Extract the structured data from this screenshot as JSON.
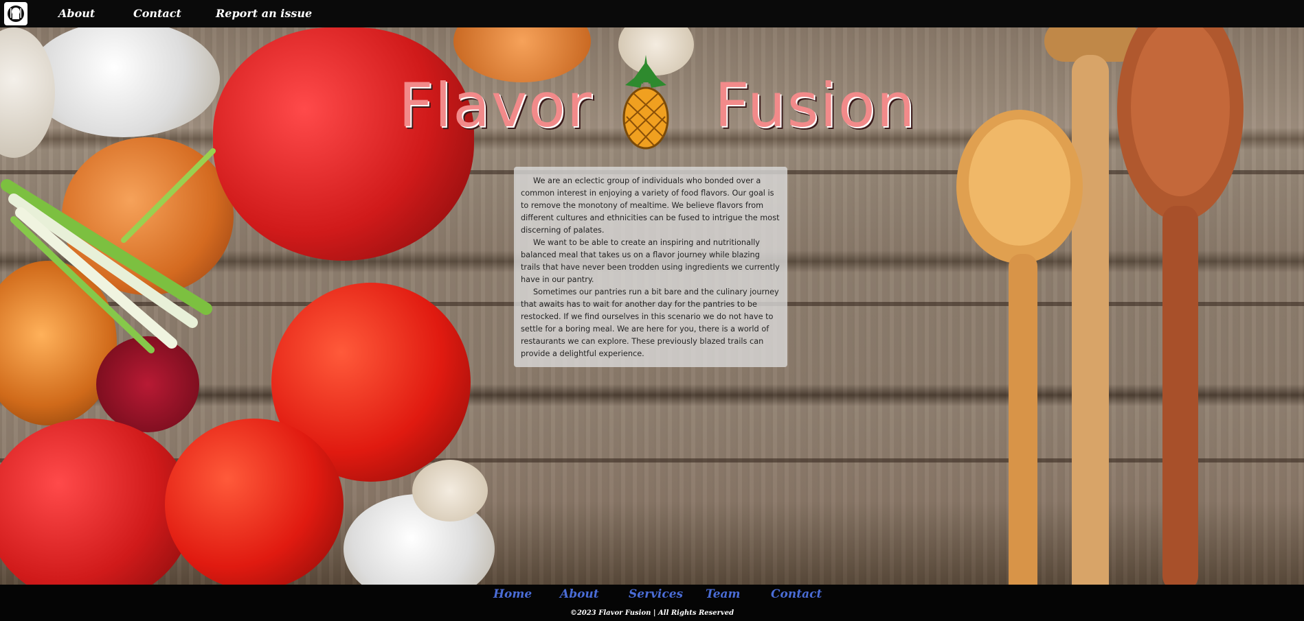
{
  "topnav": {
    "logo_icon": "chef-utensils-icon",
    "links": [
      "About",
      "Contact",
      "Report an issue"
    ]
  },
  "hero": {
    "title_left": "Flavor",
    "title_right": "Fusion",
    "title_color": "#f28a8a",
    "divider_icon": "pineapple-icon"
  },
  "about": {
    "paragraphs": [
      "We are an eclectic group of individuals who bonded over a common interest in enjoying a variety of food flavors. Our goal is to remove the monotony of mealtime. We believe flavors from different cultures and ethnicities can be fused to intrigue the most discerning of palates.",
      "We want to be able to create an inspiring and nutritionally balanced meal that takes us on a flavor journey while blazing trails that have never been trodden using ingredients we currently have in our pantry.",
      "Sometimes our pantries run a bit bare and the culinary journey that awaits has to wait for another day for the pantries to be restocked. If we find ourselves in this scenario we do not have to settle for a boring meal. We are here for you, there is a world of restaurants we can explore. These previously blazed trails can provide a delightful experience."
    ]
  },
  "footer": {
    "links": [
      "Home",
      "About",
      "Services",
      "Team",
      "Contact"
    ],
    "link_color": "#4a6cd6",
    "copyright": "©2023 Flavor Fusion | All Rights Reserved"
  }
}
